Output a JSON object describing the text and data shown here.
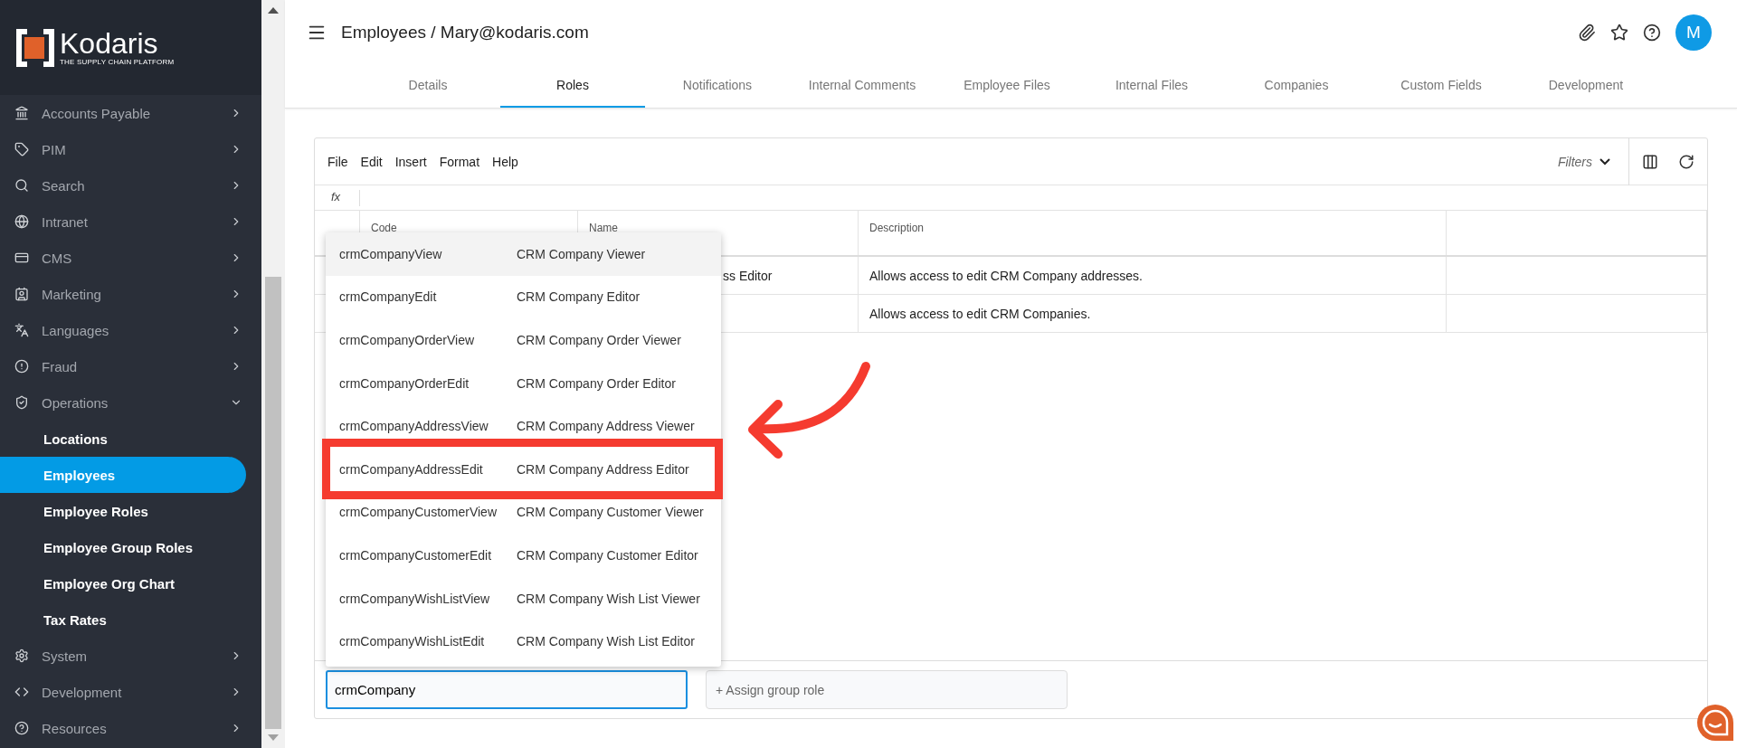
{
  "sidebar": {
    "brand": {
      "name": "Kodaris",
      "tagline": "THE SUPPLY CHAIN PLATFORM"
    },
    "items": [
      {
        "label": "Accounts Payable",
        "expanded": false
      },
      {
        "label": "PIM",
        "expanded": false
      },
      {
        "label": "Search",
        "expanded": false
      },
      {
        "label": "Intranet",
        "expanded": false
      },
      {
        "label": "CMS",
        "expanded": false
      },
      {
        "label": "Marketing",
        "expanded": false
      },
      {
        "label": "Languages",
        "expanded": false
      },
      {
        "label": "Fraud",
        "expanded": false
      },
      {
        "label": "Operations",
        "expanded": true,
        "children": [
          {
            "label": "Locations",
            "selected": false
          },
          {
            "label": "Employees",
            "selected": true
          },
          {
            "label": "Employee Roles",
            "selected": false
          },
          {
            "label": "Employee Group Roles",
            "selected": false
          },
          {
            "label": "Employee Org Chart",
            "selected": false
          },
          {
            "label": "Tax Rates",
            "selected": false
          }
        ]
      },
      {
        "label": "System",
        "expanded": false
      },
      {
        "label": "Development",
        "expanded": false
      },
      {
        "label": "Resources",
        "expanded": false
      }
    ]
  },
  "header": {
    "title": "Employees / Mary@kodaris.com",
    "avatar": "M"
  },
  "tabs": [
    {
      "label": "Details",
      "selected": false
    },
    {
      "label": "Roles",
      "selected": true
    },
    {
      "label": "Notifications",
      "selected": false
    },
    {
      "label": "Internal Comments",
      "selected": false
    },
    {
      "label": "Employee Files",
      "selected": false
    },
    {
      "label": "Internal Files",
      "selected": false
    },
    {
      "label": "Companies",
      "selected": false
    },
    {
      "label": "Custom Fields",
      "selected": false
    },
    {
      "label": "Development",
      "selected": false
    }
  ],
  "grid": {
    "menu": [
      "File",
      "Edit",
      "Insert",
      "Format",
      "Help"
    ],
    "filters": "Filters",
    "formula_label": "fx",
    "columns": [
      "Code",
      "Name",
      "Description"
    ],
    "rows": [
      {
        "name": "ss Editor",
        "description": "Allows access to edit CRM Company addresses."
      },
      {
        "description": "Allows access to edit CRM Companies."
      }
    ]
  },
  "dropdown": {
    "options": [
      {
        "code": "crmCompanyView",
        "name": "CRM Company Viewer",
        "selected": true,
        "marked": false
      },
      {
        "code": "crmCompanyEdit",
        "name": "CRM Company Editor",
        "selected": false,
        "marked": false
      },
      {
        "code": "crmCompanyOrderView",
        "name": "CRM Company Order Viewer",
        "selected": false,
        "marked": false
      },
      {
        "code": "crmCompanyOrderEdit",
        "name": "CRM Company Order Editor",
        "selected": false,
        "marked": false
      },
      {
        "code": "crmCompanyAddressView",
        "name": "CRM Company Address Viewer",
        "selected": false,
        "marked": false
      },
      {
        "code": "crmCompanyAddressEdit",
        "name": "CRM Company Address Editor",
        "selected": false,
        "marked": true
      },
      {
        "code": "crmCompanyCustomerView",
        "name": "CRM Company Customer Viewer",
        "selected": false,
        "marked": false
      },
      {
        "code": "crmCompanyCustomerEdit",
        "name": "CRM Company Customer Editor",
        "selected": false,
        "marked": false
      },
      {
        "code": "crmCompanyWishListView",
        "name": "CRM Company Wish List Viewer",
        "selected": false,
        "marked": false
      },
      {
        "code": "crmCompanyWishListEdit",
        "name": "CRM Company Wish List Editor",
        "selected": false,
        "marked": false
      }
    ]
  },
  "footer": {
    "role_input": {
      "value": "crmCompany"
    },
    "group_input": {
      "placeholder": "+ Assign group role"
    }
  }
}
